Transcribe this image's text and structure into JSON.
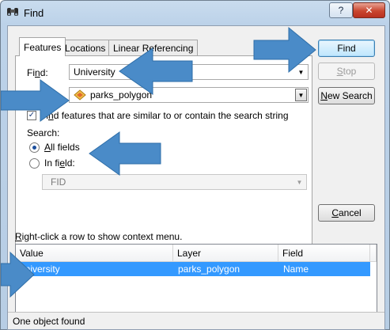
{
  "window": {
    "title": "Find",
    "help_label": "?",
    "close_label": "✕"
  },
  "tabs": [
    {
      "label": "Features",
      "active": true
    },
    {
      "label": "Locations",
      "active": false
    },
    {
      "label": "Linear Referencing",
      "active": false
    }
  ],
  "find": {
    "label_prefix": "Fi",
    "label_mnemonic": "n",
    "label_suffix": "d:",
    "value": "University"
  },
  "in_layer": {
    "value": "parks_polygon"
  },
  "similar": {
    "checked": true,
    "label_prefix": "Fi",
    "label_mnemonic": "n",
    "label_suffix": "d features that are similar to or contain the search string"
  },
  "search": {
    "label": "Search:",
    "all_fields_mnemonic": "A",
    "all_fields_rest": "ll fields",
    "in_field_prefix": "In fi",
    "in_field_mnemonic": "e",
    "in_field_suffix": "ld:",
    "selected": "all_fields",
    "field_value": "FID"
  },
  "buttons": {
    "find": "Find",
    "stop_mnemonic": "S",
    "stop_rest": "top",
    "new_search_mnemonic": "N",
    "new_search_rest": "ew Search",
    "cancel_mnemonic": "C",
    "cancel_rest": "ancel"
  },
  "results": {
    "hint_mnemonic": "R",
    "hint_rest": "ight-click a row to show context menu.",
    "columns": [
      "Value",
      "Layer",
      "Field"
    ],
    "rows": [
      {
        "value": "University",
        "layer": "parks_polygon",
        "field": "Name",
        "selected": true
      }
    ]
  },
  "status": {
    "text": "One object found"
  },
  "colors": {
    "selection": "#3399ff",
    "annotation_arrow": "#4a8bc8"
  }
}
